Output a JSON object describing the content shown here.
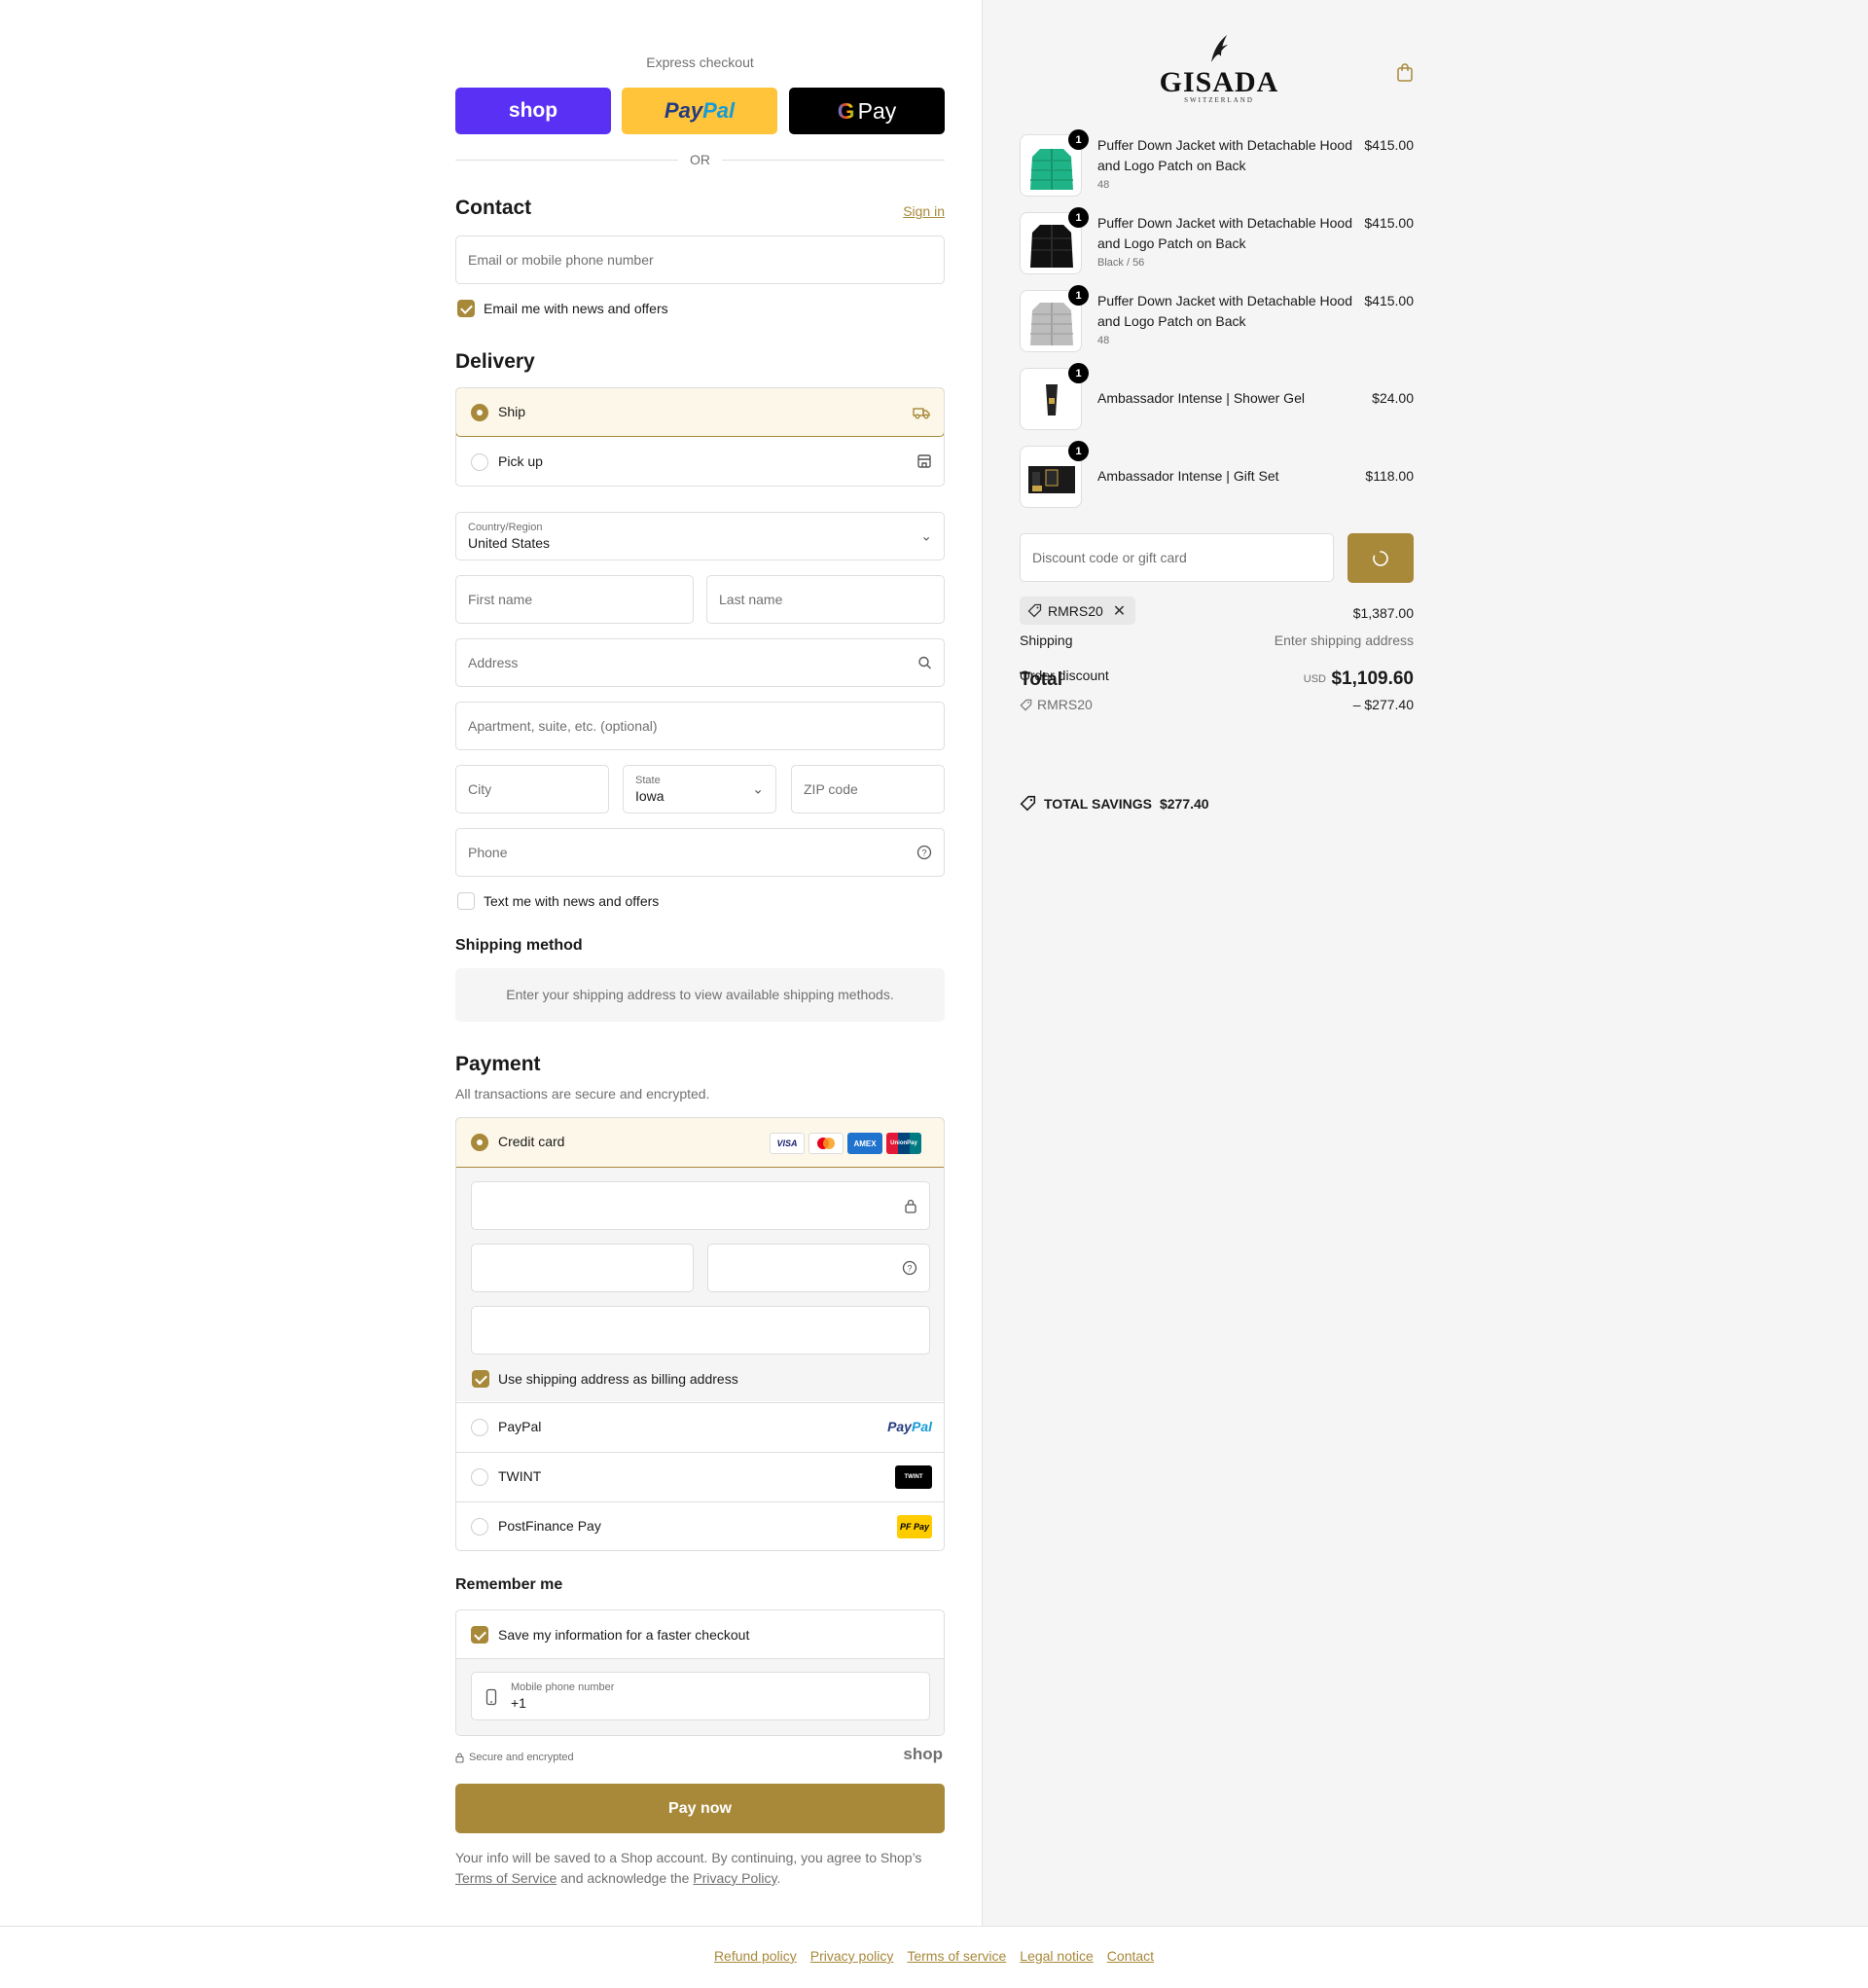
{
  "express": {
    "label": "Express checkout",
    "shop": "shop",
    "paypal_a": "Pay",
    "paypal_b": "Pal",
    "gpay_g": "G",
    "gpay": "Pay",
    "or": "OR"
  },
  "contact": {
    "title": "Contact",
    "sign_in": "Sign in",
    "email_placeholder": "Email or mobile phone number",
    "news_label": "Email me with news and offers"
  },
  "delivery": {
    "title": "Delivery",
    "ship": "Ship",
    "pickup": "Pick up",
    "country_label": "Country/Region",
    "country": "United States",
    "first_name": "First name",
    "last_name": "Last name",
    "address": "Address",
    "apartment": "Apartment, suite, etc. (optional)",
    "city": "City",
    "state_label": "State",
    "state": "Iowa",
    "zip": "ZIP code",
    "phone": "Phone",
    "text_label": "Text me with news and offers"
  },
  "shipping_method": {
    "title": "Shipping method",
    "info": "Enter your shipping address to view available shipping methods."
  },
  "payment": {
    "title": "Payment",
    "subtitle": "All transactions are secure and encrypted.",
    "credit_card": "Credit card",
    "card_logos": [
      "VISA",
      "AMEX",
      "UnionPay"
    ],
    "billing_label": "Use shipping address as billing address",
    "paypal": "PayPal",
    "paypal_logo_a": "Pay",
    "paypal_logo_b": "Pal",
    "twint": "TWINT",
    "twint_logo": "TWINT",
    "postfinance": "PostFinance Pay",
    "pf_logo": "PF Pay"
  },
  "remember": {
    "title": "Remember me",
    "save_label": "Save my information for a faster checkout",
    "mobile_label": "Mobile phone number",
    "mobile_value": "+1",
    "secure": "Secure and encrypted",
    "shop": "shop"
  },
  "pay_now": "Pay now",
  "legal": {
    "text1": "Your info will be saved to a Shop account. By continuing, you agree to Shop’s",
    "tos": "Terms of Service",
    "text2": "and acknowledge the",
    "privacy": "Privacy Policy",
    "end": "."
  },
  "brand": {
    "name": "GISADA",
    "sub": "SWITZERLAND"
  },
  "items": [
    {
      "name": "Puffer Down Jacket with Detachable Hood and Logo Patch on Back",
      "variant": "48",
      "price": "$415.00",
      "qty": "1"
    },
    {
      "name": "Puffer Down Jacket with Detachable Hood and Logo Patch on Back",
      "variant": "Black / 56",
      "price": "$415.00",
      "qty": "1"
    },
    {
      "name": "Puffer Down Jacket with Detachable Hood and Logo Patch on Back",
      "variant": "48",
      "price": "$415.00",
      "qty": "1"
    },
    {
      "name": "Ambassador Intense | Shower Gel",
      "variant": "",
      "price": "$24.00",
      "qty": "1"
    },
    {
      "name": "Ambassador Intense | Gift Set",
      "variant": "",
      "price": "$118.00",
      "qty": "1"
    }
  ],
  "discount": {
    "placeholder": "Discount code or gift card",
    "code": "RMRS20"
  },
  "summary": {
    "subtotal": "$1,387.00",
    "shipping_label": "Shipping",
    "shipping_value": "Enter shipping address",
    "total_label": "Total",
    "currency": "USD",
    "total": "$1,109.60",
    "order_discount_label": "Order discount",
    "discount_code": "RMRS20",
    "discount_value": "– $277.40",
    "savings_label": "TOTAL SAVINGS",
    "savings_value": "$277.40"
  },
  "footer": [
    "Refund policy",
    "Privacy policy",
    "Terms of service",
    "Legal notice",
    "Contact"
  ],
  "colors": {
    "accent": "#a8893a",
    "shop": "#5a31f4",
    "paypal": "#ffc439"
  }
}
